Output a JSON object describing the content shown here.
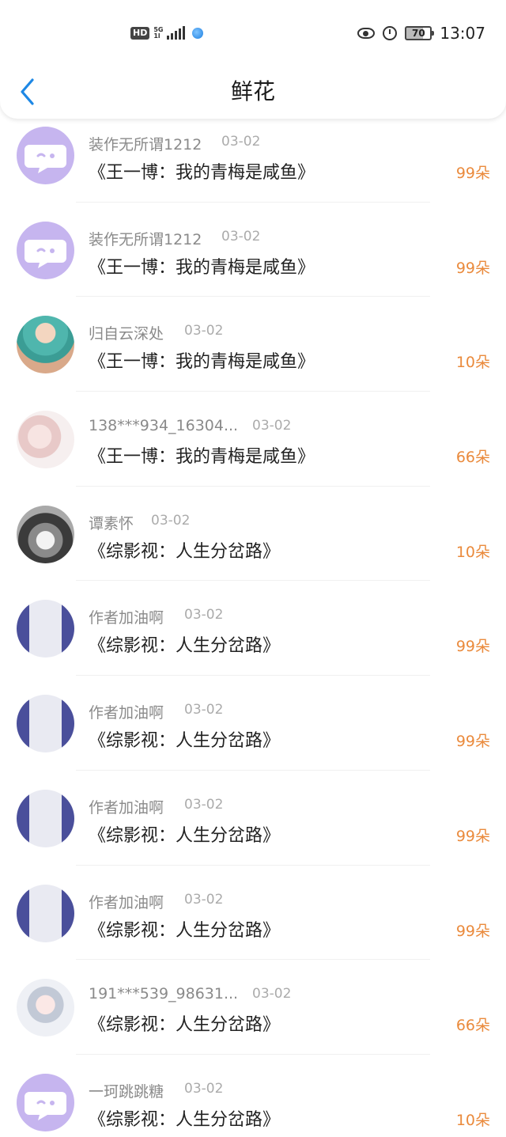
{
  "status_bar": {
    "hd": "HD",
    "network_top": "5G",
    "network_bottom": "1l",
    "battery": "70",
    "time": "13:07"
  },
  "header": {
    "title": "鲜花"
  },
  "colors": {
    "accent_blue": "#1e88e5",
    "count_orange": "#ea8a3c"
  },
  "items": [
    {
      "user": "装作无所谓1212",
      "date": "03-02",
      "book": "《王一博：我的青梅是咸鱼》",
      "count": "99朵",
      "avatar": "default-avatar"
    },
    {
      "user": "装作无所谓1212",
      "date": "03-02",
      "book": "《王一博：我的青梅是咸鱼》",
      "count": "99朵",
      "avatar": "default-avatar"
    },
    {
      "user": "归自云深处",
      "date": "03-02",
      "book": "《王一博：我的青梅是咸鱼》",
      "count": "10朵",
      "avatar": "figure-avatar"
    },
    {
      "user": "138***934_16304...",
      "date": "03-02",
      "book": "《王一博：我的青梅是咸鱼》",
      "count": "66朵",
      "avatar": "girl-avatar"
    },
    {
      "user": "谭素怀",
      "date": "03-02",
      "book": "《综影视：人生分岔路》",
      "count": "10朵",
      "avatar": "husky-avatar"
    },
    {
      "user": "作者加油啊",
      "date": "03-02",
      "book": "《综影视：人生分岔路》",
      "count": "99朵",
      "avatar": "curtain-avatar"
    },
    {
      "user": "作者加油啊",
      "date": "03-02",
      "book": "《综影视：人生分岔路》",
      "count": "99朵",
      "avatar": "curtain-avatar"
    },
    {
      "user": "作者加油啊",
      "date": "03-02",
      "book": "《综影视：人生分岔路》",
      "count": "99朵",
      "avatar": "curtain-avatar"
    },
    {
      "user": "作者加油啊",
      "date": "03-02",
      "book": "《综影视：人生分岔路》",
      "count": "99朵",
      "avatar": "curtain-avatar"
    },
    {
      "user": "191***539_98631...",
      "date": "03-02",
      "book": "《综影视：人生分岔路》",
      "count": "66朵",
      "avatar": "anime-avatar"
    },
    {
      "user": "一珂跳跳糖",
      "date": "03-02",
      "book": "《综影视：人生分岔路》",
      "count": "10朵",
      "avatar": "default-avatar"
    }
  ]
}
